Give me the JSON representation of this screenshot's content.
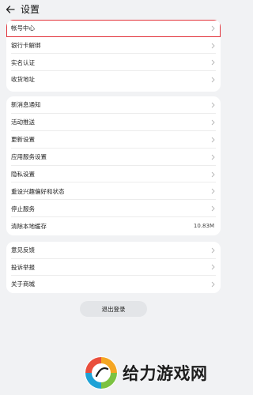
{
  "header": {
    "title": "设置",
    "back_icon": "arrow-left-icon"
  },
  "sections": [
    {
      "items": [
        {
          "label": "帐号中心",
          "highlighted": true
        },
        {
          "label": "银行卡解绑"
        },
        {
          "label": "实名认证"
        },
        {
          "label": "收货地址"
        }
      ]
    },
    {
      "items": [
        {
          "label": "新消息通知"
        },
        {
          "label": "活动推送"
        },
        {
          "label": "更新设置"
        },
        {
          "label": "应用服务设置"
        },
        {
          "label": "隐私设置"
        },
        {
          "label": "重设兴趣偏好和状态"
        },
        {
          "label": "停止服务"
        },
        {
          "label": "清除本地缓存",
          "value": "10.83M"
        }
      ]
    },
    {
      "items": [
        {
          "label": "意见反馈"
        },
        {
          "label": "投诉举报"
        },
        {
          "label": "关于商城"
        }
      ]
    }
  ],
  "logout_label": "退出登录",
  "watermark": {
    "text": "给力游戏网"
  },
  "colors": {
    "highlight": "#e2333a",
    "background": "#f1f2f4",
    "card": "#ffffff"
  }
}
